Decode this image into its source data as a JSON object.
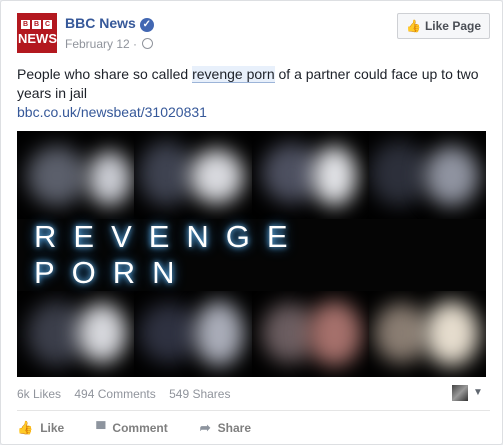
{
  "post": {
    "page_name": "BBC News",
    "avatar": {
      "top": "BBC",
      "bottom": "NEWS"
    },
    "verified_icon": "verified-badge-icon",
    "date": "February 12",
    "separator": "·",
    "privacy_icon": "globe-icon",
    "like_page_label": "Like Page",
    "text_before": "People who share so called ",
    "text_highlight": "revenge porn",
    "text_after": " of a partner could face up to two years in jail",
    "link": "bbc.co.uk/newsbeat/31020831",
    "image_title": "REVENGE PORN"
  },
  "stats": {
    "likes": "6k Likes",
    "comments": "494 Comments",
    "shares": "549 Shares"
  },
  "actions": {
    "like": "Like",
    "comment": "Comment",
    "share": "Share"
  },
  "colors": {
    "brand_red": "#b3181f",
    "link_blue": "#365899",
    "banner_glow": "#6ec3ff"
  }
}
